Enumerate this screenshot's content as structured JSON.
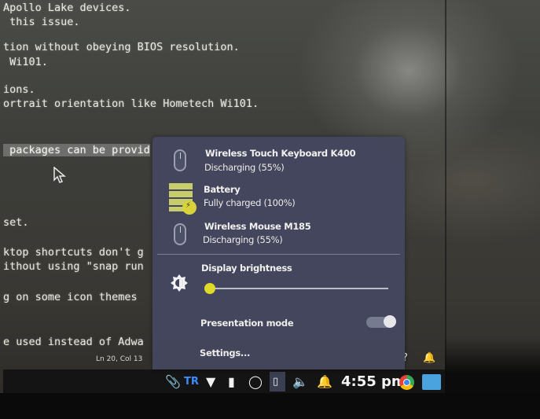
{
  "terminal": {
    "lines": [
      "Apollo Lake devices.",
      " this issue.",
      "tion without obeying BIOS resolution.",
      " Wi101.",
      "ions.",
      "ortrait orientation like Hometech Wi101.",
      " packages can be provid",
      "set.",
      "ktop shortcuts don't g",
      "ithout using \"snap run",
      "g on some icon themes",
      "e used instead of Adwa"
    ],
    "status": "Ln 20, Col 13"
  },
  "popup": {
    "devices": [
      {
        "name": "Wireless Touch Keyboard K400",
        "status": "Discharging (55%)",
        "icon": "mouse-icon"
      },
      {
        "name": "Battery",
        "status": "Fully charged (100%)",
        "icon": "battery-icon"
      },
      {
        "name": "Wireless Mouse M185",
        "status": "Discharging (55%)",
        "icon": "mouse-icon"
      }
    ],
    "brightness_label": "Display brightness",
    "brightness_level": 0.0,
    "presentation_label": "Presentation mode",
    "presentation_enabled": true,
    "settings_label": "Settings..."
  },
  "taskbar": {
    "keyboard_layout": "TR",
    "time": "4:55 pm",
    "icons": [
      "paperclip-icon",
      "wifi-icon",
      "phone-icon",
      "disk-icon",
      "battery-icon",
      "volume-icon",
      "bell-icon",
      "chrome-icon",
      "vscode-icon"
    ]
  },
  "colors": {
    "popup_bg": "#44475e",
    "accent_yellow": "#e0da2b",
    "taskbar_bg": "#141414"
  }
}
